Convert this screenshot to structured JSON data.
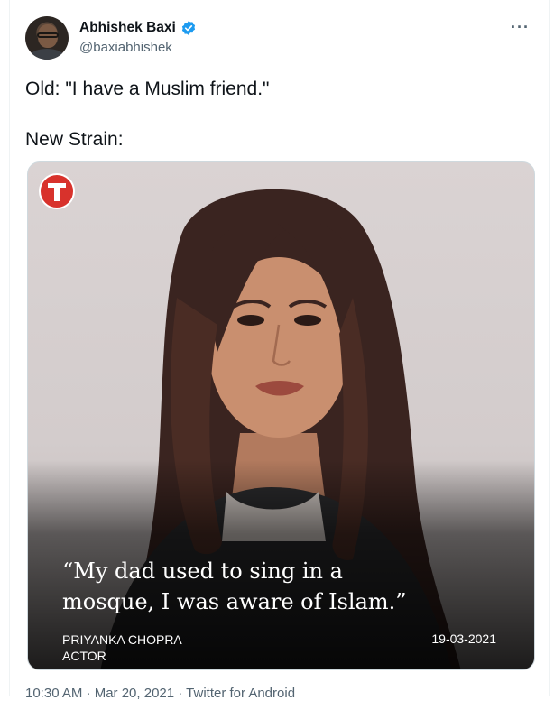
{
  "tweet": {
    "author": {
      "display_name": "Abhishek Baxi",
      "handle": "@baxiabhishek",
      "verified_icon": "verified-badge-icon",
      "verified_color": "#1d9bf0"
    },
    "more_label": "···",
    "text_lines": [
      "Old: \"I have a Muslim friend.\"",
      "New Strain:"
    ],
    "media": {
      "logo_letter": "T",
      "logo_color": "#d8322c",
      "quote_lines": [
        "“My dad used to sing in a",
        "mosque, I was aware of Islam.”"
      ],
      "person_name": "PRIYANKA CHOPRA",
      "person_title": "ACTOR",
      "date": "19-03-2021"
    },
    "meta": "10:30 AM · Mar 20, 2021 · Twitter for Android"
  }
}
